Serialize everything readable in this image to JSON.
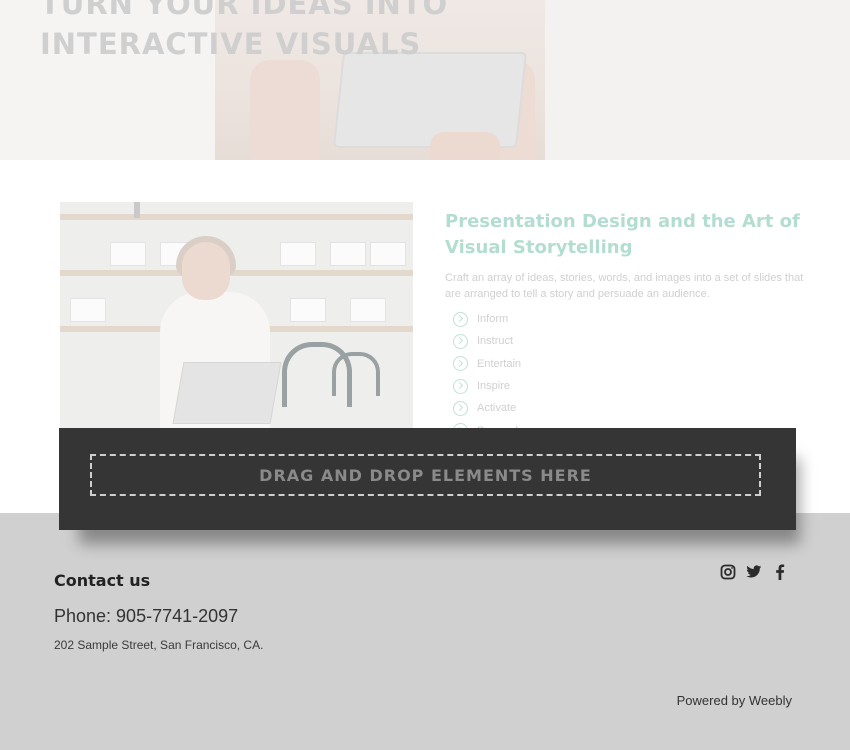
{
  "hero": {
    "title_line1": "TURN YOUR IDEAS INTO",
    "title_line2": "INTERACTIVE VISUALS"
  },
  "presentation": {
    "title": "Presentation Design and the Art of Visual Storytelling",
    "description": "Craft an array of ideas, stories, words, and images into a set of slides that are arranged to tell a story and persuade an audience.",
    "features": [
      {
        "label": "Inform"
      },
      {
        "label": "Instruct"
      },
      {
        "label": "Entertain"
      },
      {
        "label": "Inspire"
      },
      {
        "label": "Activate"
      },
      {
        "label": "Persuade"
      }
    ]
  },
  "drop_zone": {
    "label": "DRAG AND DROP ELEMENTS HERE"
  },
  "footer": {
    "contact_heading": "Contact us",
    "phone": "Phone: 905-7741-2097",
    "address": "202 Sample Street, San Francisco, CA.",
    "powered_by": "Powered by Weebly",
    "social_icons": [
      "instagram-icon",
      "twitter-icon",
      "facebook-icon"
    ]
  },
  "colors": {
    "accent": "#b3ddd0",
    "drop_bar": "#353535",
    "footer_bg": "#d0d0d0"
  }
}
